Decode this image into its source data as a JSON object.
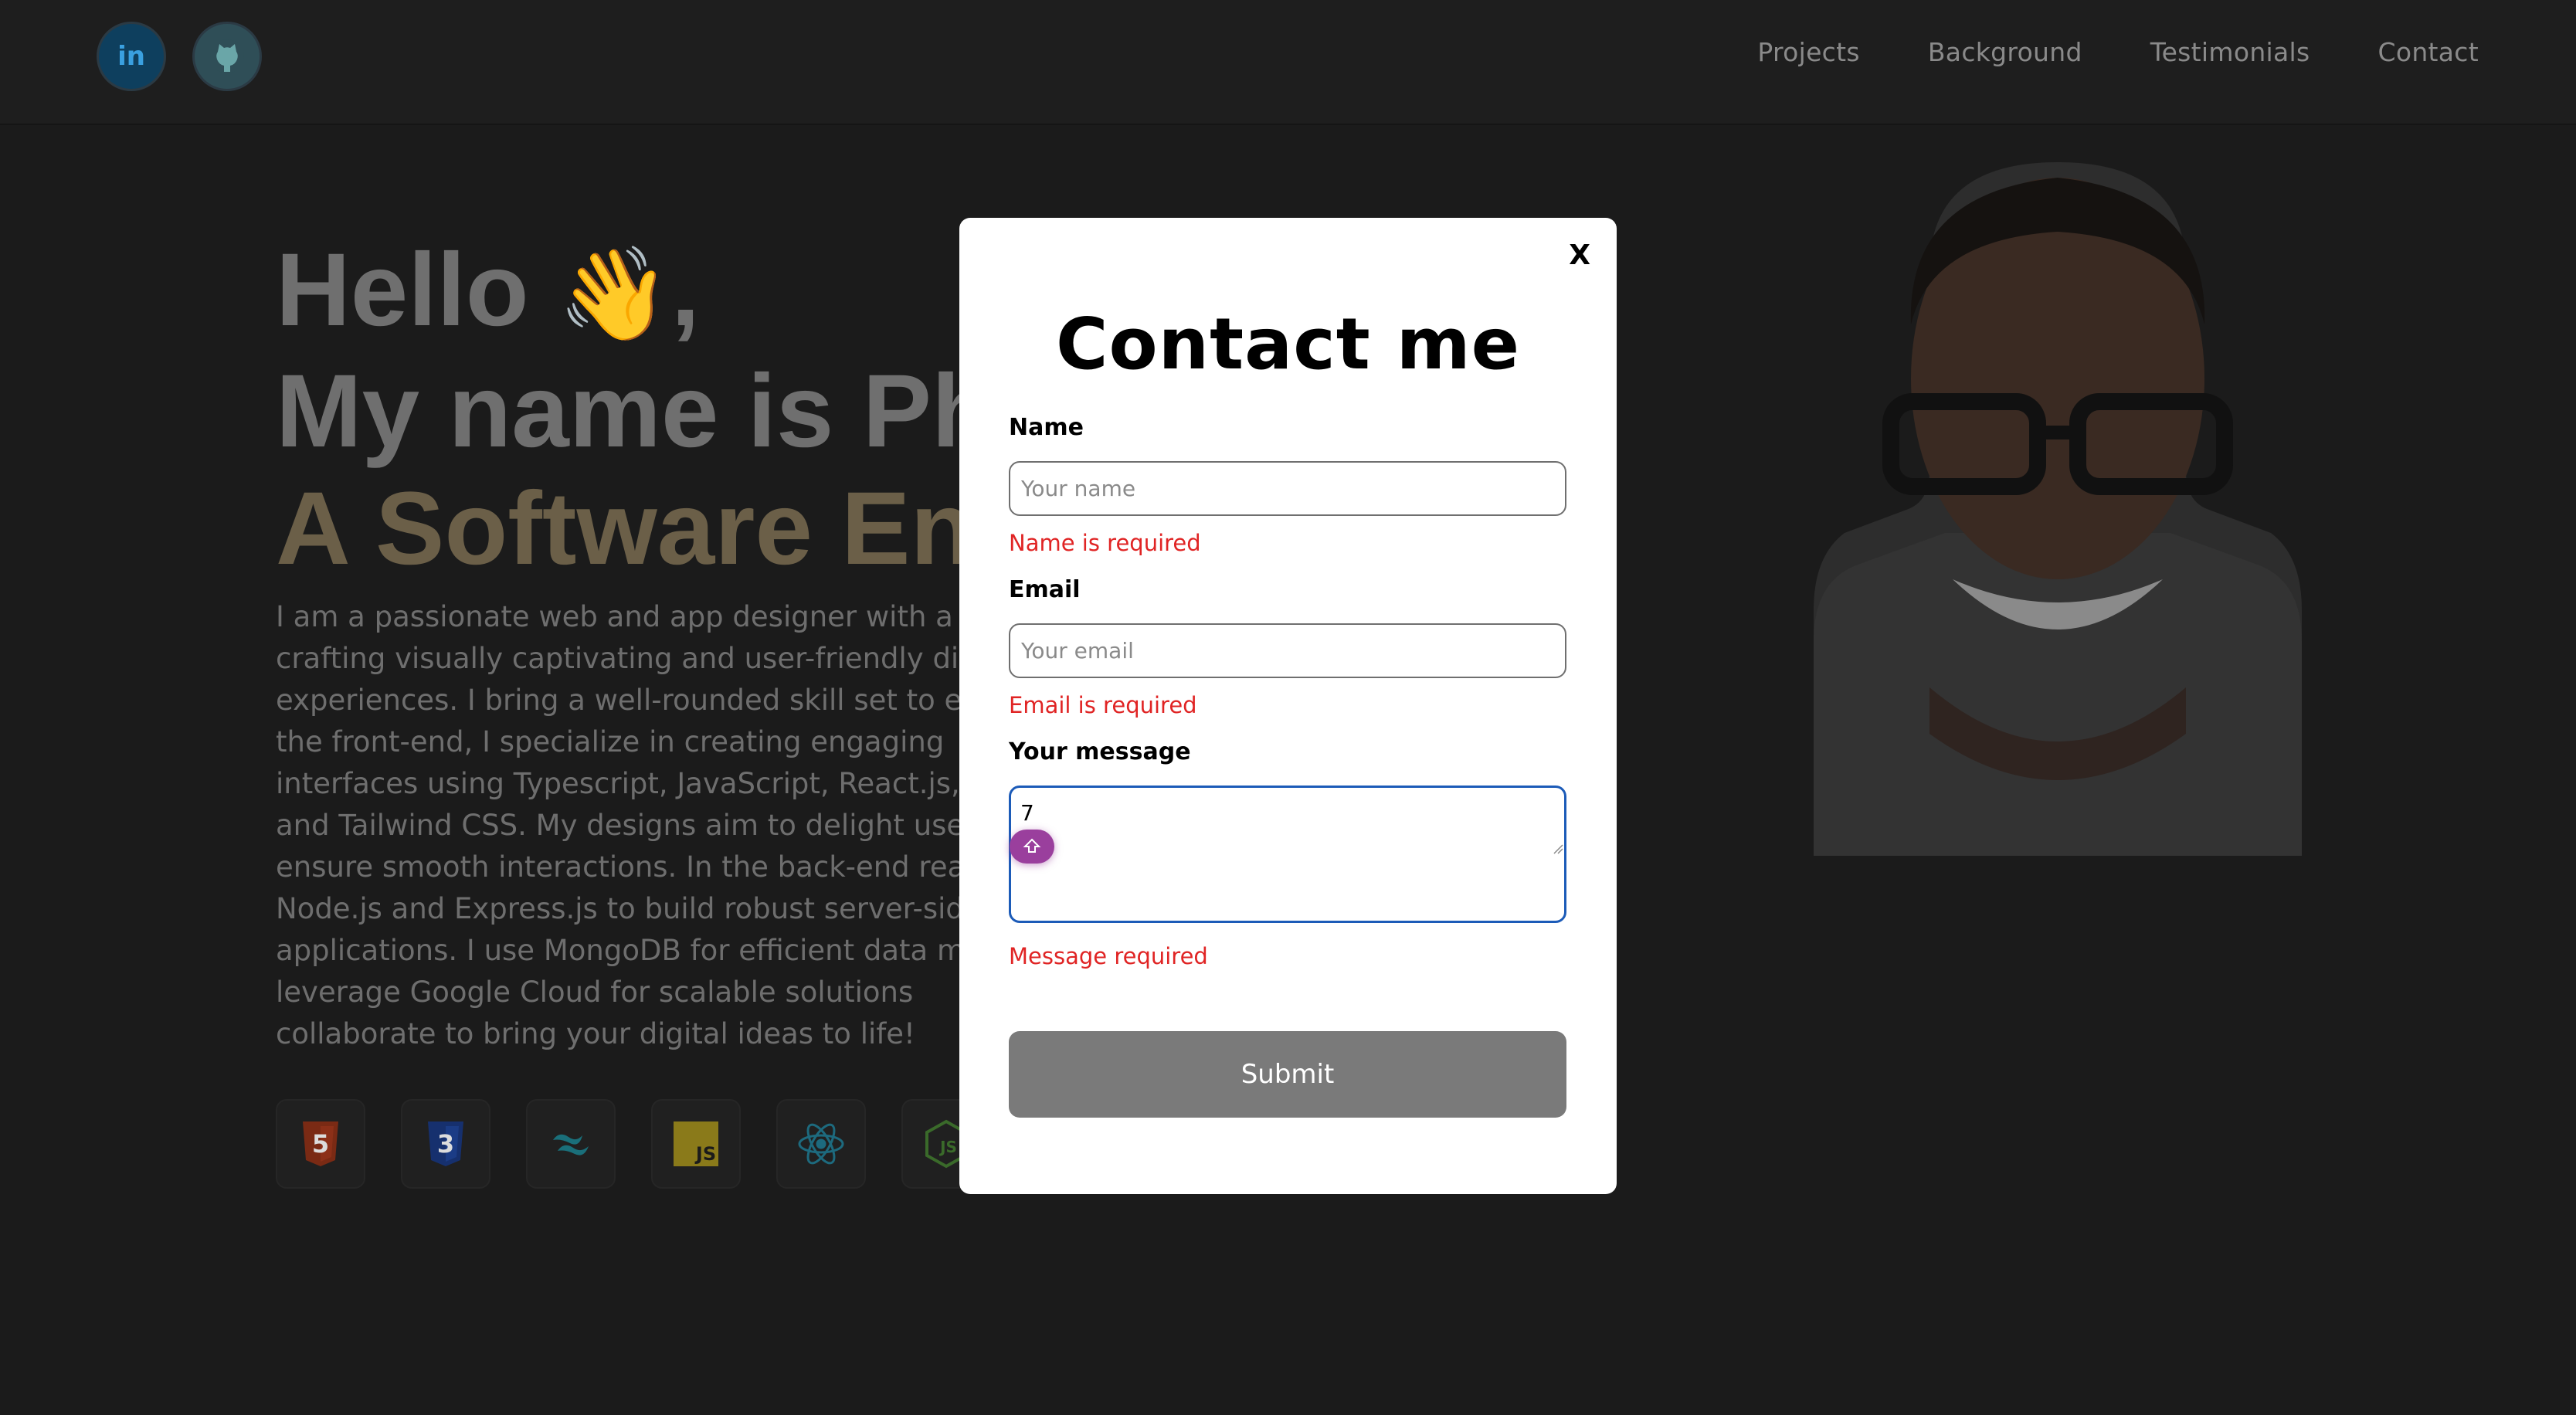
{
  "header": {
    "social": [
      {
        "name": "LinkedIn",
        "icon": "linkedin-icon",
        "glyph": "in"
      },
      {
        "name": "GitHub",
        "icon": "github-icon"
      }
    ],
    "nav": [
      "Projects",
      "Background",
      "Testimonials",
      "Contact"
    ]
  },
  "hero": {
    "line1": "Hello",
    "wave": "👋",
    "comma": ",",
    "line2": "My name is Ph",
    "line3": "A Software Eng",
    "description": "I am a passionate web and app designer with a k crafting visually captivating and user-friendly dig experiences. I bring a well-rounded skill set to eve On the front-end, I specialize in creating engaging interfaces using Typescript, JavaScript, React.js, H and Tailwind CSS. My designs aim to delight users ensure smooth interactions. In the back-end real Node.js and Express.js to build robust server-side applications. I use MongoDB for efficient data ma and leverage Google Cloud for scalable solutions collaborate to bring your digital ideas to life!",
    "tech_icons": [
      "html5-icon",
      "css3-icon",
      "tailwind-icon",
      "javascript-icon",
      "react-icon",
      "nodejs-icon"
    ],
    "js_label": "JS",
    "nodejs_label": "JS"
  },
  "modal": {
    "close_label": "X",
    "title": "Contact me",
    "name": {
      "label": "Name",
      "placeholder": "Your name",
      "value": "",
      "error": "Name is required"
    },
    "email": {
      "label": "Email",
      "placeholder": "Your email",
      "value": "",
      "error": "Email is required"
    },
    "message": {
      "label": "Your message",
      "value": "7",
      "error": "Message required"
    },
    "submit_label": "Submit"
  },
  "colors": {
    "background": "#1b1b1b",
    "accent_text": "#6b5f48",
    "error": "#e02424",
    "focus": "#1c5bb8",
    "submit_bg": "#7a7a7a",
    "badge": "#9a3f9d"
  }
}
